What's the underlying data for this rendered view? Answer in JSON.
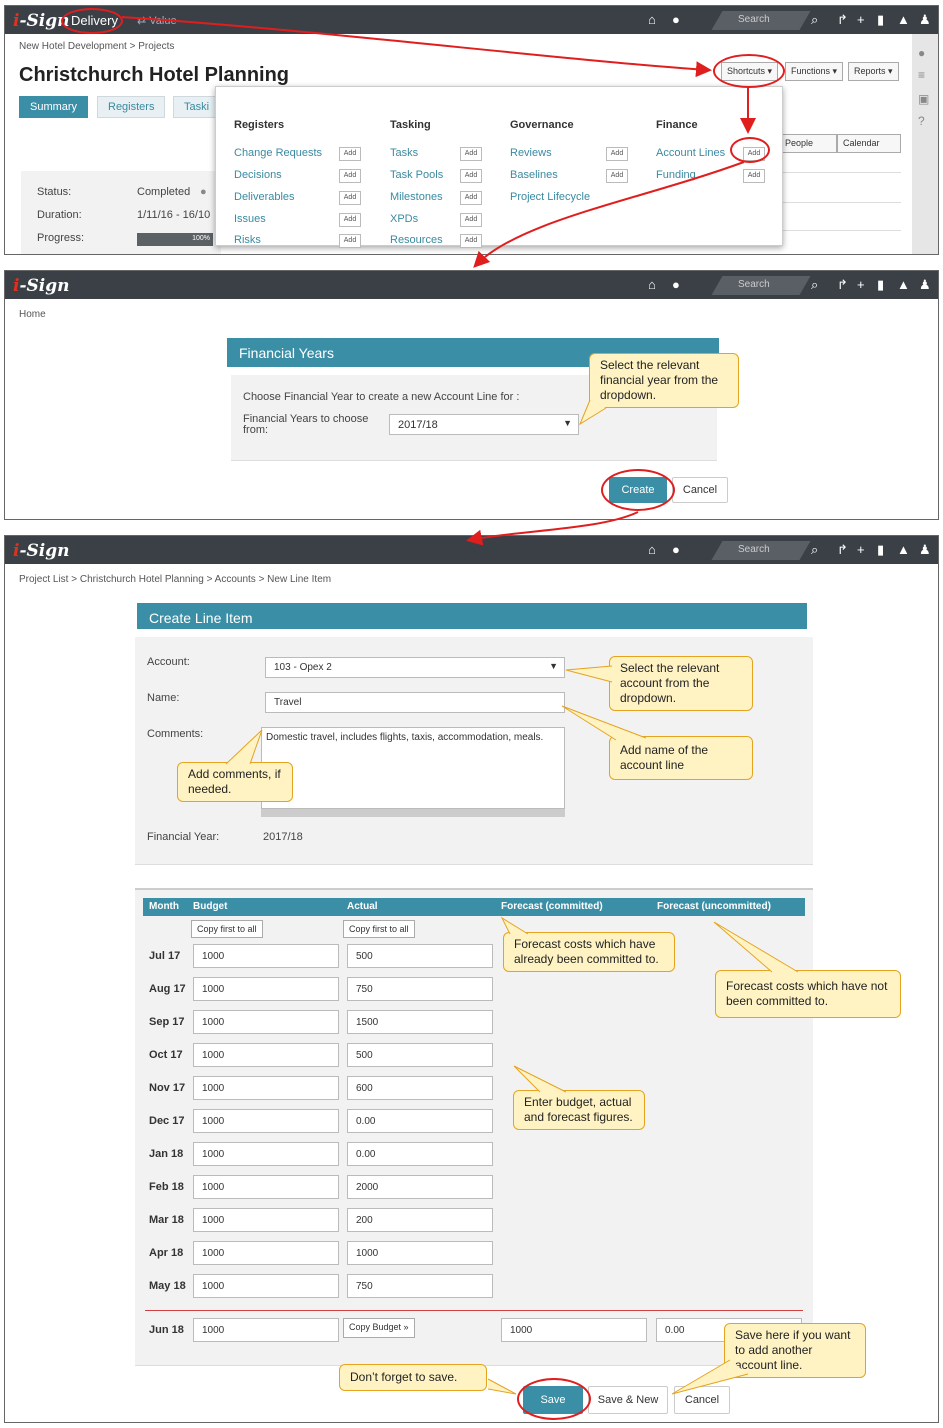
{
  "brand": {
    "logo": "i-Sign"
  },
  "panel1": {
    "nav": {
      "delivery": "Delivery",
      "value": "⇄ Value"
    },
    "search_placeholder": "Search",
    "breadcrumb": "New Hotel Development > Projects",
    "title": "Christchurch Hotel Planning",
    "tabs": [
      "Summary",
      "Registers",
      "Taski"
    ],
    "buttons": {
      "shortcuts": "Shortcuts ▾",
      "functions": "Functions ▾",
      "reports": "Reports ▾",
      "people": "People",
      "calendar": "Calendar"
    },
    "shortcuts_menu": {
      "add_label": "Add",
      "columns": [
        {
          "heading": "Registers",
          "items": [
            "Change Requests",
            "Decisions",
            "Deliverables",
            "Issues",
            "Risks"
          ]
        },
        {
          "heading": "Tasking",
          "items": [
            "Tasks",
            "Task Pools",
            "Milestones",
            "XPDs",
            "Resources"
          ]
        },
        {
          "heading": "Governance",
          "items": [
            "Reviews",
            "Baselines",
            "Project Lifecycle"
          ]
        },
        {
          "heading": "Finance",
          "items": [
            "Account Lines",
            "Funding"
          ]
        }
      ]
    },
    "summary": {
      "status_label": "Status:",
      "status_value": "Completed",
      "duration_label": "Duration:",
      "duration_value": "1/11/16 - 16/10",
      "progress_label": "Progress:",
      "progress_value": "100%",
      "progress_fraction": 1.0
    }
  },
  "panel2": {
    "search_placeholder": "Search",
    "breadcrumb": "Home",
    "header": "Financial Years",
    "prompt": "Choose Financial Year to create a new Account Line for :",
    "field_label": "Financial Years to choose from:",
    "selected_year": "2017/18",
    "create": "Create",
    "cancel": "Cancel",
    "callout": "Select the relevant financial year from the dropdown."
  },
  "panel3": {
    "search_placeholder": "Search",
    "breadcrumb": "Project List > Christchurch Hotel Planning > Accounts > New Line Item",
    "header": "Create Line Item",
    "account_label": "Account:",
    "account_value": "103 - Opex 2",
    "name_label": "Name:",
    "name_value": "Travel",
    "comments_label": "Comments:",
    "comments_value": "Domestic travel, includes flights, taxis, accommodation, meals.",
    "fy_label": "Financial Year:",
    "fy_value": "2017/18",
    "columns": {
      "month": "Month",
      "budget": "Budget",
      "actual": "Actual",
      "forecast_committed": "Forecast (committed)",
      "forecast_uncommitted": "Forecast (uncommitted)"
    },
    "copy_first": "Copy first to all",
    "copy_budget": "Copy Budget »",
    "rows": [
      {
        "month": "Jul 17",
        "budget": "1000",
        "actual": "500"
      },
      {
        "month": "Aug 17",
        "budget": "1000",
        "actual": "750"
      },
      {
        "month": "Sep 17",
        "budget": "1000",
        "actual": "1500"
      },
      {
        "month": "Oct 17",
        "budget": "1000",
        "actual": "500"
      },
      {
        "month": "Nov 17",
        "budget": "1000",
        "actual": "600"
      },
      {
        "month": "Dec 17",
        "budget": "1000",
        "actual": "0.00"
      },
      {
        "month": "Jan 18",
        "budget": "1000",
        "actual": "0.00"
      },
      {
        "month": "Feb 18",
        "budget": "1000",
        "actual": "2000"
      },
      {
        "month": "Mar 18",
        "budget": "1000",
        "actual": "200"
      },
      {
        "month": "Apr 18",
        "budget": "1000",
        "actual": "1000"
      },
      {
        "month": "May 18",
        "budget": "1000",
        "actual": "750"
      }
    ],
    "last_row": {
      "month": "Jun 18",
      "budget": "1000",
      "forecast_committed": "1000",
      "forecast_uncommitted": "0.00"
    },
    "save": "Save",
    "save_new": "Save & New",
    "cancel": "Cancel",
    "callouts": {
      "account": "Select the relevant account from the dropdown.",
      "name": "Add name of the account line",
      "comments": "Add comments, if needed.",
      "committed": "Forecast costs which have already been committed to.",
      "uncommitted": "Forecast costs which have not been committed to.",
      "enter": "Enter budget, actual and forecast figures.",
      "save_new": "Save here if you want to add another account line.",
      "save": "Don’t forget to save."
    }
  },
  "colors": {
    "topbar": "#3b4047",
    "accent": "#3a8fa6",
    "annotation": "#e01e1e",
    "callout_fill": "#fff3c4",
    "callout_border": "#e5a320"
  },
  "icons": [
    "home-icon",
    "globe-icon",
    "search-icon",
    "share-icon",
    "plus-icon",
    "bookmark-icon",
    "bell-icon",
    "user-icon",
    "chat-icon",
    "list-icon",
    "lock-icon",
    "help-icon"
  ]
}
